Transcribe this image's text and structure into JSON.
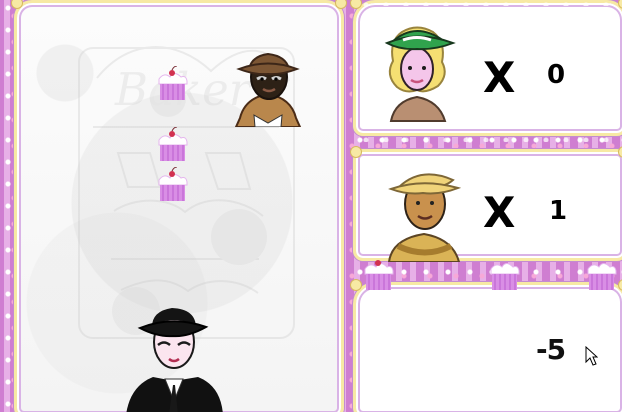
{
  "colors": {
    "background": "#dc9ce0",
    "frame_gold": "#f7e9a4",
    "frame_lilac": "#d9b3e6",
    "panel_white": "#ffffff",
    "cupcake_pink": "#d98ee5",
    "cherry_red": "#d23250"
  },
  "scoreboard": {
    "row_1": {
      "character": "woman-green-hat",
      "multiplier": "X",
      "count": "0"
    },
    "row_2": {
      "character": "man-yellow-cap",
      "multiplier": "X",
      "count": "1"
    }
  },
  "status": {
    "score": "-5"
  },
  "board": {
    "characters": [
      {
        "name": "cupcake-customer",
        "icon": "man-brown-hat"
      },
      {
        "name": "player",
        "icon": "man-black-hat"
      }
    ],
    "items": [
      "cupcake",
      "cupcake",
      "cupcake"
    ]
  }
}
